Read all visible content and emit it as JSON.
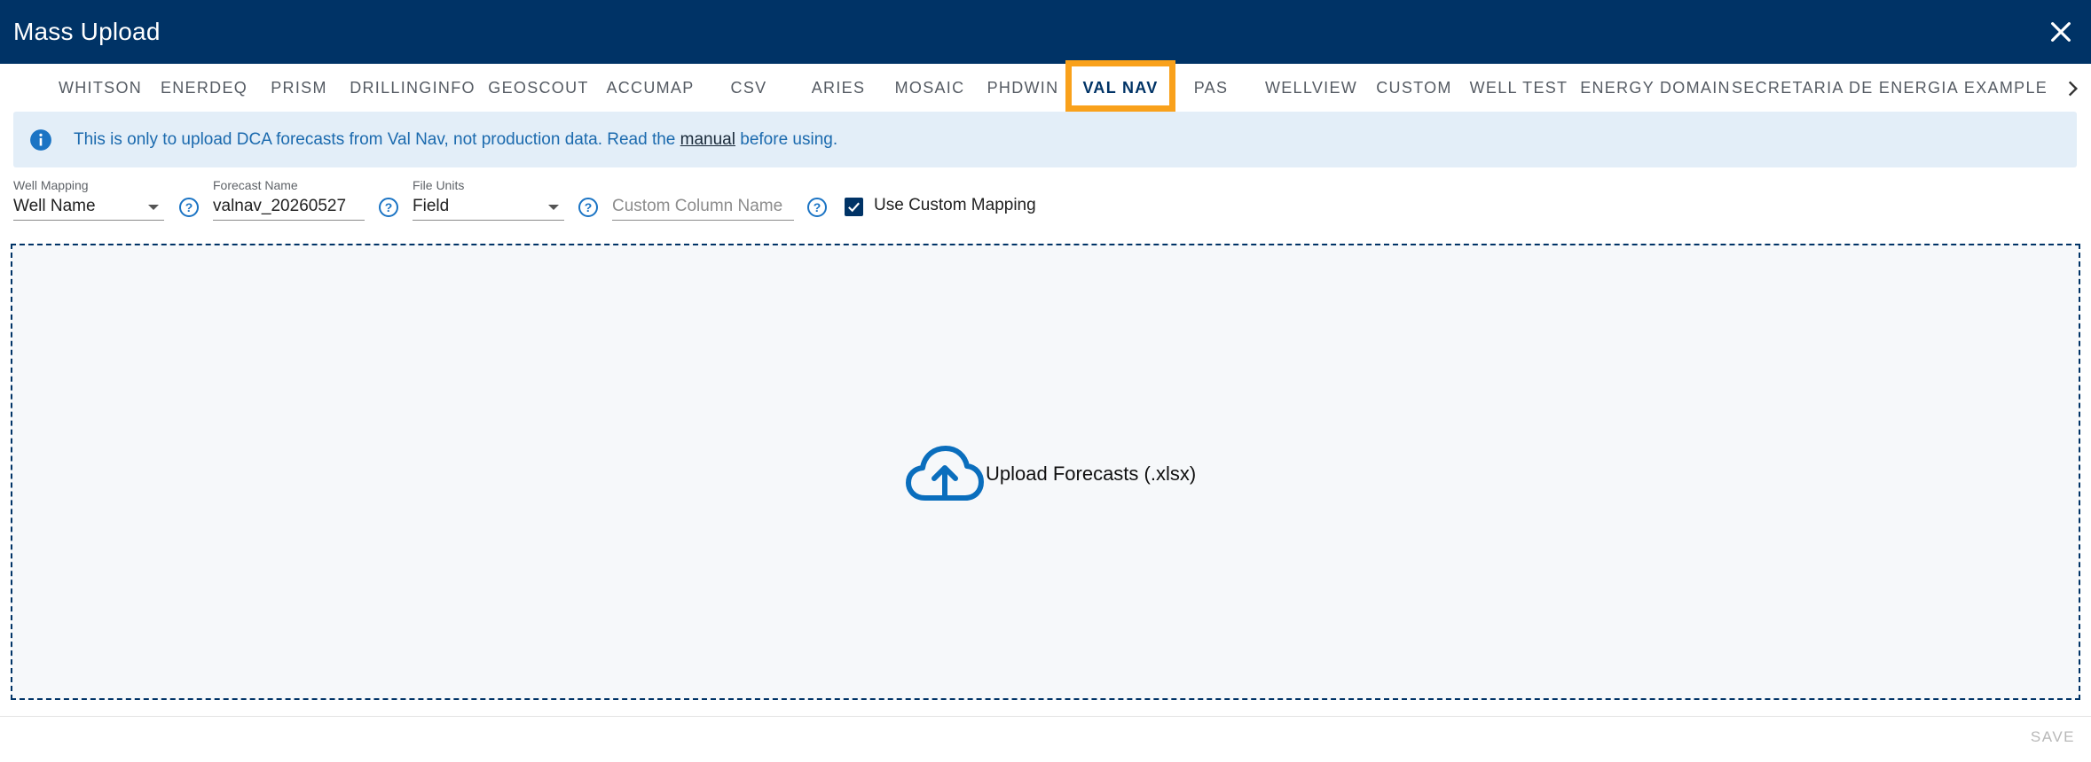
{
  "dialog": {
    "title": "Mass Upload"
  },
  "tabs": [
    {
      "label": "WHITSON"
    },
    {
      "label": "ENERDEQ"
    },
    {
      "label": "PRISM"
    },
    {
      "label": "DRILLINGINFO"
    },
    {
      "label": "GEOSCOUT"
    },
    {
      "label": "ACCUMAP"
    },
    {
      "label": "CSV"
    },
    {
      "label": "ARIES"
    },
    {
      "label": "MOSAIC"
    },
    {
      "label": "PHDWIN"
    },
    {
      "label": "VAL NAV",
      "active": true
    },
    {
      "label": "PAS"
    },
    {
      "label": "WELLVIEW"
    },
    {
      "label": "CUSTOM"
    },
    {
      "label": "WELL TEST"
    },
    {
      "label": "ENERGY DOMAIN"
    },
    {
      "label": "SECRETARIA DE ENERGIA"
    },
    {
      "label": "EXAMPLE"
    }
  ],
  "alert": {
    "prefix": "This is only to upload DCA forecasts from Val Nav, not production data. Read the ",
    "link": "manual",
    "suffix": " before using."
  },
  "form": {
    "well_mapping": {
      "label": "Well Mapping",
      "value": "Well Name"
    },
    "forecast_name": {
      "label": "Forecast Name",
      "value": "valnav_20260527"
    },
    "file_units": {
      "label": "File Units",
      "value": "Field"
    },
    "custom_column": {
      "placeholder": "Custom Column Name"
    },
    "use_custom_mapping": {
      "label": "Use Custom Mapping",
      "checked": true
    }
  },
  "dropzone": {
    "label": "Upload Forecasts (.xlsx)"
  },
  "footer": {
    "save_label": "SAVE"
  },
  "colors": {
    "header": "#003366",
    "accent": "#0a6ebd",
    "highlight": "#f9a11b",
    "alert_bg": "#e3eef8"
  }
}
